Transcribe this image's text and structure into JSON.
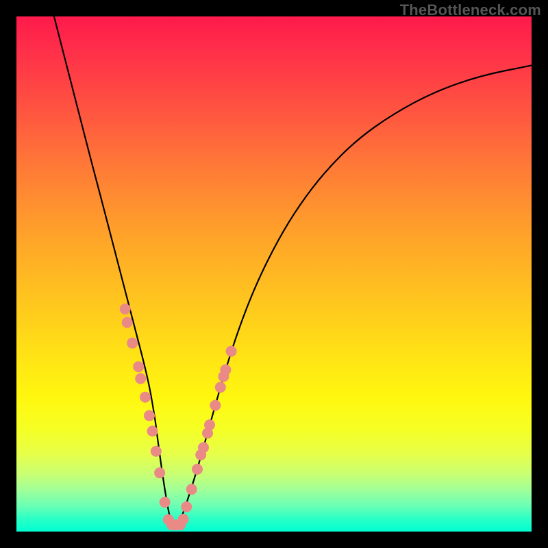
{
  "watermark": "TheBottleneck.com",
  "chart_data": {
    "type": "line",
    "title": "",
    "xlabel": "",
    "ylabel": "",
    "xlim": [
      0,
      100
    ],
    "ylim": [
      0,
      100
    ],
    "grid": false,
    "legend": false,
    "series": [
      {
        "name": "curve",
        "x": [
          7.3,
          10.9,
          14.5,
          18.2,
          21.8,
          25.5,
          26.9,
          27.4,
          28.5,
          29.5,
          30.2,
          31.5,
          34.5,
          37.5,
          40.0,
          43.0,
          46.5,
          50.7,
          55.0,
          60.0,
          66.0,
          73.0,
          81.0,
          90.0,
          100.0
        ],
        "y": [
          100.0,
          86.0,
          72.0,
          58.0,
          44.0,
          30.0,
          22.0,
          18.0,
          10.0,
          4.0,
          1.0,
          1.0,
          10.0,
          20.5,
          29.5,
          39.0,
          48.0,
          56.5,
          63.5,
          70.0,
          76.0,
          81.0,
          85.3,
          88.5,
          90.5
        ],
        "note": "x and y are percentages of plot width/height; y measured from bottom"
      }
    ],
    "markers": [
      {
        "x": 21.1,
        "y": 43.2
      },
      {
        "x": 21.5,
        "y": 40.6
      },
      {
        "x": 22.5,
        "y": 36.6
      },
      {
        "x": 23.7,
        "y": 32.0
      },
      {
        "x": 24.1,
        "y": 29.7
      },
      {
        "x": 25.0,
        "y": 26.1
      },
      {
        "x": 25.8,
        "y": 22.5
      },
      {
        "x": 26.4,
        "y": 19.5
      },
      {
        "x": 27.1,
        "y": 15.6
      },
      {
        "x": 27.8,
        "y": 11.4
      },
      {
        "x": 28.8,
        "y": 5.7
      },
      {
        "x": 29.5,
        "y": 2.3
      },
      {
        "x": 30.2,
        "y": 1.3
      },
      {
        "x": 31.0,
        "y": 1.3
      },
      {
        "x": 31.8,
        "y": 1.3
      },
      {
        "x": 32.4,
        "y": 2.4
      },
      {
        "x": 33.0,
        "y": 4.8
      },
      {
        "x": 34.0,
        "y": 8.2
      },
      {
        "x": 35.1,
        "y": 12.1
      },
      {
        "x": 35.8,
        "y": 14.9
      },
      {
        "x": 36.3,
        "y": 16.3
      },
      {
        "x": 37.1,
        "y": 19.1
      },
      {
        "x": 37.5,
        "y": 20.7
      },
      {
        "x": 38.6,
        "y": 24.5
      },
      {
        "x": 39.6,
        "y": 28.0
      },
      {
        "x": 40.2,
        "y": 30.1
      },
      {
        "x": 40.6,
        "y": 31.4
      },
      {
        "x": 41.7,
        "y": 35.0
      }
    ],
    "background_gradient": {
      "0.00": "#ff1a4b",
      "0.50": "#ffbd21",
      "0.80": "#f6ff24",
      "1.00": "#00ffd2"
    }
  }
}
